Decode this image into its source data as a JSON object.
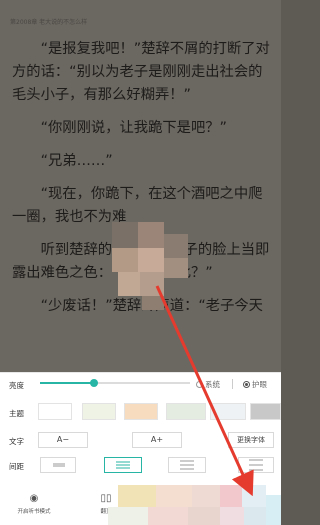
{
  "reader": {
    "chapter_header": "第2008章 老大说的不怎么样",
    "paragraphs": [
      "“是报复我吧！”楚辞不屑的打断了对方的话：“别以为老子是刚刚走出社会的毛头小子，有那么好糊弄！”",
      "“你刚刚说，让我跪下是吧？”",
      "“兄弟……”",
      "“现在，你跪下，在这个酒吧之中爬一圈，我也不为难",
      "听到楚辞的话，青年男子的脸上当即露出难色之色：“真的要如此？”",
      "“少废话！”楚辞冷声道：“老子今天"
    ]
  },
  "panel": {
    "brightness_label": "亮度",
    "brightness_level": 0.36,
    "system_option": "系统",
    "eye_option": "护眼",
    "theme_label": "主题",
    "theme_colors": [
      "#ffffff",
      "#eef3e6",
      "#f8dcc0",
      "#e4ece2",
      "#eef2f4",
      "#c8c8c8"
    ],
    "font_label": "文字",
    "font_decrease": "A−",
    "font_increase": "A+",
    "change_font": "更换字体",
    "spacing_label": "间距",
    "accent_color": "#27b6a6",
    "nav": {
      "listen": "开启听书模式",
      "page_turn": "翻页"
    }
  }
}
